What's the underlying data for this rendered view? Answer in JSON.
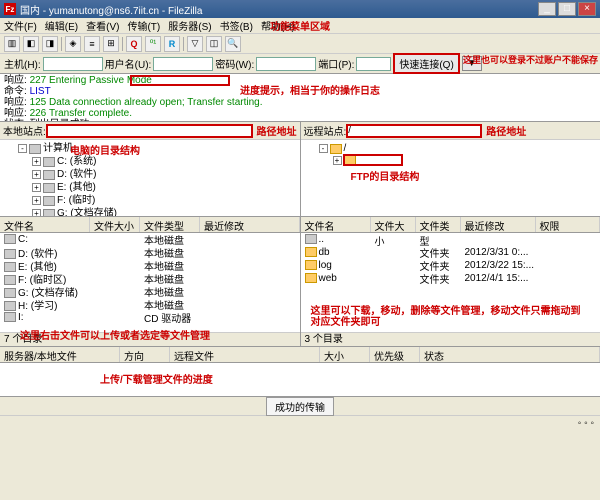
{
  "window": {
    "title": "国内 - yumanutong@ns6.7iit.cn - FileZilla",
    "icon_text": "Fz"
  },
  "menu": [
    "文件(F)",
    "编辑(E)",
    "查看(V)",
    "传输(T)",
    "服务器(S)",
    "书签(B)",
    "帮助(H)"
  ],
  "annotations": {
    "menu_area": "功能菜单区域",
    "log_hint": "进度提示，相当于你的操作日志",
    "login_hint": "这里也可以登录不过账户不能保存",
    "local_path": "路径地址",
    "remote_path": "路径地址",
    "local_tree": "电脑的目录结构",
    "remote_tree": "FTP的目录结构",
    "local_files": "这里右击文件可以上传或者选定等文件管理",
    "remote_files": "这里可以下载，移动，删除等文件管理，移动文件只需拖动到对应文件夹即可",
    "queue": "上传/下载管理文件的进度"
  },
  "quickconnect": {
    "host_label": "主机(H):",
    "user_label": "用户名(U):",
    "pass_label": "密码(W):",
    "port_label": "端口(P):",
    "button": "快速连接(Q)",
    "dropdown": "▼"
  },
  "log": [
    {
      "label": "响应:",
      "msg": "227 Entering Passive Mode",
      "cls": "green"
    },
    {
      "label": "命令:",
      "msg": "LIST",
      "cls": "blue"
    },
    {
      "label": "响应:",
      "msg": "125 Data connection already open; Transfer starting.",
      "cls": "green"
    },
    {
      "label": "响应:",
      "msg": "226 Transfer complete.",
      "cls": "green"
    },
    {
      "label": "状态:",
      "msg": "列出目录成功",
      "cls": "black"
    }
  ],
  "local": {
    "path_label": "本地站点:",
    "path_value": "",
    "tree": [
      {
        "indent": 1,
        "exp": "-",
        "ico": "drive",
        "label": "计算机"
      },
      {
        "indent": 2,
        "exp": "+",
        "ico": "drive",
        "label": "C: (系统)"
      },
      {
        "indent": 2,
        "exp": "+",
        "ico": "drive",
        "label": "D: (软件)"
      },
      {
        "indent": 2,
        "exp": "+",
        "ico": "drive",
        "label": "E: (其他)"
      },
      {
        "indent": 2,
        "exp": "+",
        "ico": "drive",
        "label": "F: (临时)"
      },
      {
        "indent": 2,
        "exp": "+",
        "ico": "drive",
        "label": "G: (文档存储)"
      }
    ],
    "cols": [
      "文件名",
      "文件大小",
      "文件类型",
      "最近修改"
    ],
    "files": [
      {
        "name": "C:",
        "type": "本地磁盘"
      },
      {
        "name": "D: (软件)",
        "type": "本地磁盘"
      },
      {
        "name": "E: (其他)",
        "type": "本地磁盘"
      },
      {
        "name": "F: (临时区)",
        "type": "本地磁盘"
      },
      {
        "name": "G: (文档存储)",
        "type": "本地磁盘"
      },
      {
        "name": "H: (学习)",
        "type": "本地磁盘"
      },
      {
        "name": "I:",
        "type": "CD 驱动器"
      }
    ],
    "status": "7 个目录"
  },
  "remote": {
    "path_label": "远程站点:",
    "path_value": "/",
    "tree": [
      {
        "indent": 1,
        "exp": "-",
        "ico": "folder",
        "label": "/"
      },
      {
        "indent": 2,
        "exp": "+",
        "ico": "folder",
        "label": ""
      }
    ],
    "cols": [
      "文件名",
      "文件大小",
      "文件类型",
      "最近修改",
      "权限"
    ],
    "files": [
      {
        "name": "..",
        "type": "",
        "date": ""
      },
      {
        "name": "db",
        "type": "文件夹",
        "date": "2012/3/31 0:..."
      },
      {
        "name": "log",
        "type": "文件夹",
        "date": "2012/3/22 15:..."
      },
      {
        "name": "web",
        "type": "文件夹",
        "date": "2012/4/1 15:..."
      }
    ],
    "status": "3 个目录"
  },
  "queue": {
    "cols": [
      "服务器/本地文件",
      "方向",
      "远程文件",
      "大小",
      "优先级",
      "状态"
    ]
  },
  "tabs": {
    "success": "成功的传输"
  },
  "toolbar_icons": [
    "site-manager-icon",
    "disconnect-icon",
    "reconnect-icon",
    "",
    "queue-icon",
    "log-icon",
    "tree-icon",
    "",
    "Q",
    "binary-icon",
    "R",
    "",
    "filter-icon",
    "compare-icon",
    "search-icon"
  ]
}
